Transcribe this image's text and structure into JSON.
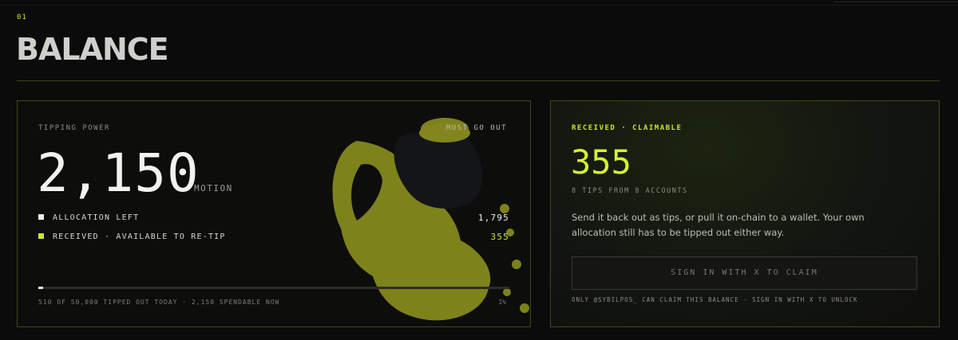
{
  "section": {
    "number": "01",
    "title": "BALANCE"
  },
  "tipping_card": {
    "label": "TIPPING POWER",
    "tag": "MUST GO OUT",
    "amount": "2,150",
    "unit": "MOTION",
    "rows": [
      {
        "label": "ALLOCATION LEFT",
        "value": "1,795"
      },
      {
        "label": "RECEIVED · AVAILABLE TO RE-TIP",
        "value": "355"
      }
    ],
    "progress_fraction": 0.01,
    "progress_caption": "510 OF 50,000 TIPPED OUT TODAY · 2,150 SPENDABLE NOW",
    "progress_percent_label": "1%",
    "mascot": "yellow-hooded-figure-with-coin-bag-illustration"
  },
  "received_card": {
    "label": "RECEIVED · CLAIMABLE",
    "amount": "355",
    "subtitle": "8 TIPS FROM 8 ACCOUNTS",
    "description": "Send it back out as tips, or pull it on-chain to a wallet. Your own allocation still has to be tipped out either way.",
    "claim_button": "SIGN IN WITH X TO CLAIM",
    "note": "ONLY @SYBILPOS_ CAN CLAIM THIS BALANCE · SIGN IN WITH X TO UNLOCK"
  },
  "colors": {
    "accent": "#c7e92e",
    "background": "#0b0b0b",
    "border": "#3f4b14"
  }
}
